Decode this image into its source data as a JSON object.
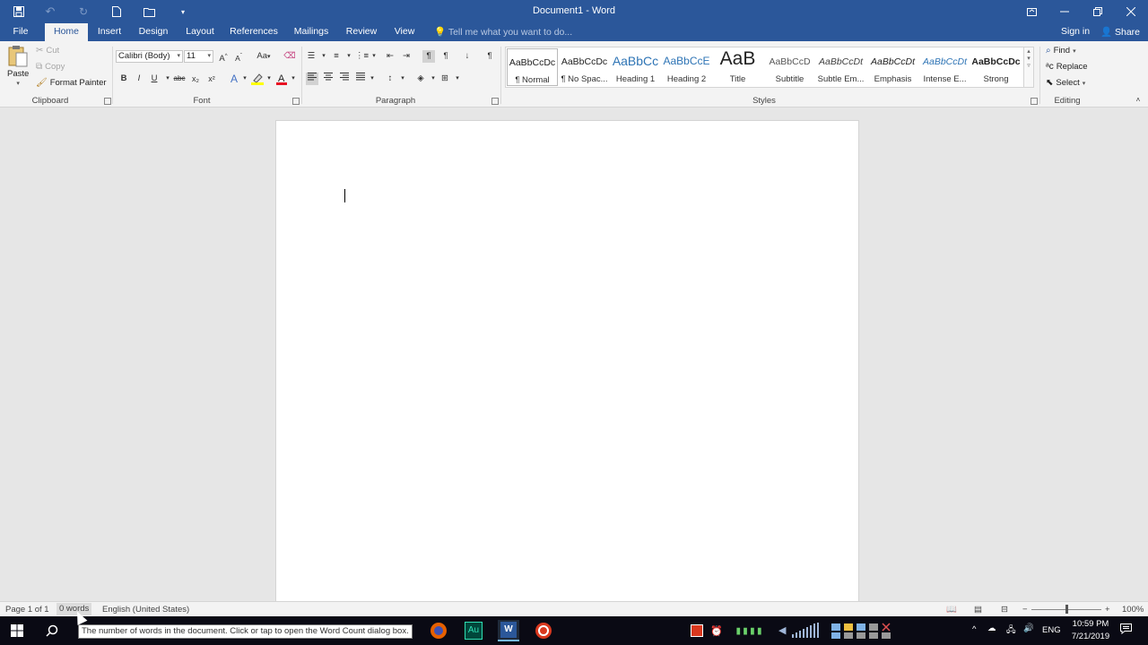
{
  "titlebar": {
    "doc_title": "Document1 - Word",
    "save_icon": "save-icon",
    "undo_icon": "undo-icon",
    "redo_icon": "redo-icon",
    "new_icon": "new-document-icon",
    "open_icon": "open-folder-icon",
    "customize_icon": "customize-quick-access-icon"
  },
  "tabs": [
    "File",
    "Home",
    "Insert",
    "Design",
    "Layout",
    "References",
    "Mailings",
    "Review",
    "View"
  ],
  "active_tab": "Home",
  "tellme": "Tell me what you want to do...",
  "signin": "Sign in",
  "share": "Share",
  "clipboard": {
    "paste": "Paste",
    "cut": "Cut",
    "copy": "Copy",
    "format_painter": "Format Painter",
    "label": "Clipboard"
  },
  "font": {
    "family": "Calibri (Body)",
    "size": "11",
    "label": "Font",
    "bold": "B",
    "italic": "I",
    "underline": "U",
    "strike": "abc",
    "subscript": "x₂",
    "superscript": "x²",
    "change_case": "Aa"
  },
  "paragraph": {
    "label": "Paragraph"
  },
  "styles": {
    "label": "Styles",
    "items": [
      {
        "preview": "AaBbCcDc",
        "name": "¶ Normal",
        "color": "#000000"
      },
      {
        "preview": "AaBbCcDc",
        "name": "¶ No Spac...",
        "color": "#000000"
      },
      {
        "preview": "AaBbCc",
        "name": "Heading 1",
        "color": "#2e74b5"
      },
      {
        "preview": "AaBbCcE",
        "name": "Heading 2",
        "color": "#2e74b5"
      },
      {
        "preview": "AaB",
        "name": "Title",
        "color": "#000000"
      },
      {
        "preview": "AaBbCcD",
        "name": "Subtitle",
        "color": "#595959"
      },
      {
        "preview": "AaBbCcDt",
        "name": "Subtle Em...",
        "color": "#404040"
      },
      {
        "preview": "AaBbCcDt",
        "name": "Emphasis",
        "color": "#000000"
      },
      {
        "preview": "AaBbCcDt",
        "name": "Intense E...",
        "color": "#2e74b5"
      },
      {
        "preview": "AaBbCcDc",
        "name": "Strong",
        "color": "#000000"
      }
    ]
  },
  "editing": {
    "label": "Editing",
    "find": "Find",
    "replace": "Replace",
    "select": "Select"
  },
  "statusbar": {
    "page": "Page 1 of 1",
    "words": "0 words",
    "language": "English (United States)",
    "zoom": "100%"
  },
  "tooltip": "The number of words in the document. Click or tap to open the Word Count dialog box.",
  "taskbar": {
    "time": "10:59 PM",
    "date": "7/21/2019",
    "lang": "ENG",
    "audition_label": "Au"
  },
  "colors": {
    "brand": "#2b579a",
    "ribbon": "#f3f3f3",
    "canvas": "#e6e6e6"
  }
}
